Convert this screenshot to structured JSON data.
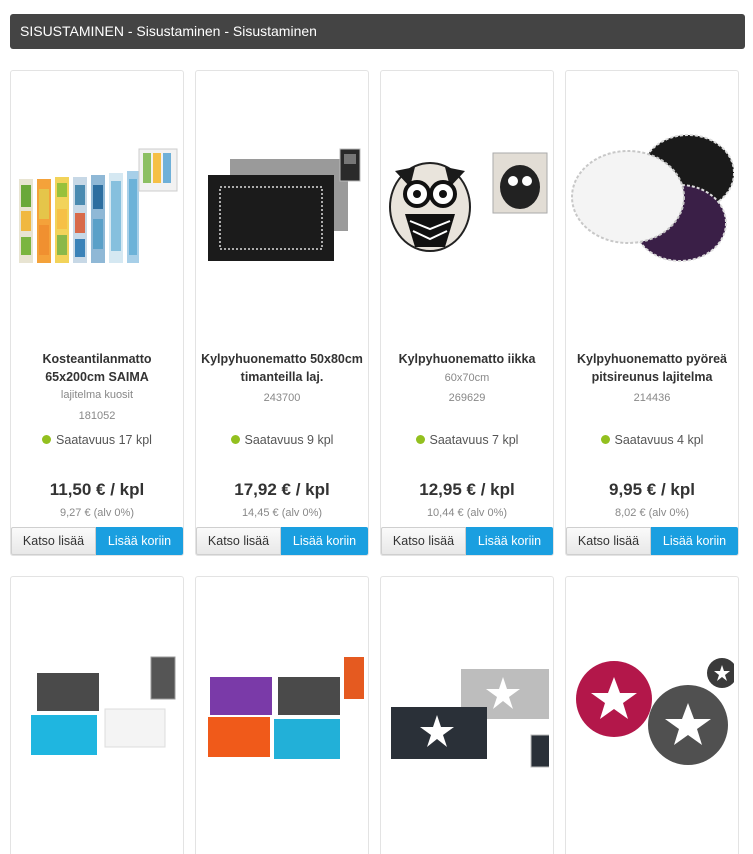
{
  "breadcrumb": {
    "text": "SISUSTAMINEN - Sisustaminen - Sisustaminen"
  },
  "buttons": {
    "more_label": "Katso lisää",
    "cart_label": "Lisää koriin"
  },
  "colors": {
    "header_bg": "#444444",
    "cart_button": "#1a9fe0",
    "availability_dot": "#93c01f"
  },
  "products": [
    {
      "title_line1": "Kosteantilanmatto",
      "title_line2": "65x200cm SAIMA",
      "subtitle": "lajitelma kuosit",
      "code": "181052",
      "availability": "Saatavuus 17 kpl",
      "price": "11,50 € / kpl",
      "vat_price": "9,27 € (alv 0%)"
    },
    {
      "title_line1": "Kylpyhuonematto 50x80cm",
      "title_line2": "timanteilla laj.",
      "subtitle": "",
      "code": "243700",
      "availability": "Saatavuus 9 kpl",
      "price": "17,92 € / kpl",
      "vat_price": "14,45 € (alv 0%)"
    },
    {
      "title_line1": "Kylpyhuonematto iikka",
      "title_line2": "",
      "subtitle": "60x70cm",
      "code": "269629",
      "availability": "Saatavuus 7 kpl",
      "price": "12,95 € / kpl",
      "vat_price": "10,44 € (alv 0%)"
    },
    {
      "title_line1": "Kylpyhuonematto pyöreä",
      "title_line2": "pitsireunus lajitelma",
      "subtitle": "",
      "code": "214436",
      "availability": "Saatavuus 4 kpl",
      "price": "9,95 € / kpl",
      "vat_price": "8,02 € (alv 0%)"
    }
  ]
}
